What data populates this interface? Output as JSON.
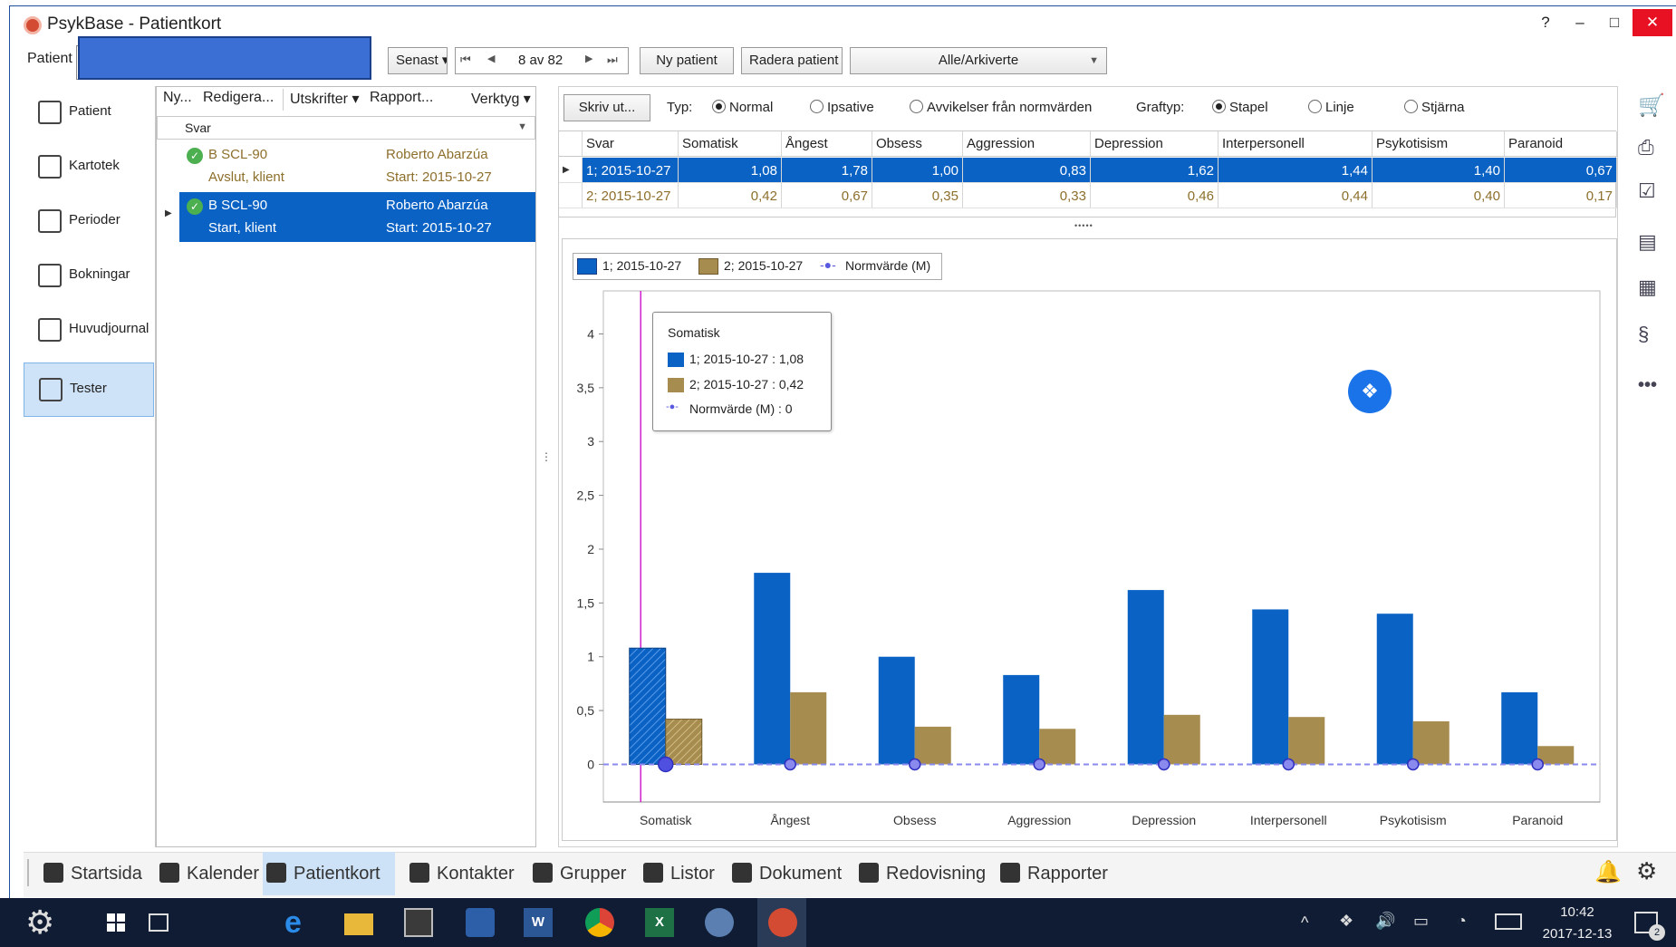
{
  "window": {
    "title": "PsykBase - Patientkort",
    "help": "?",
    "minimize": "–",
    "maximize": "□",
    "close": "✕"
  },
  "toolbar": {
    "patient_label": "Patient",
    "senast": "Senast ▾",
    "first": "⏮",
    "prev": "◀",
    "position": "8 av 82",
    "next": "▶",
    "last": "⏭",
    "new_patient": "Ny patient",
    "delete_patient": "Radera patient",
    "filter_value": "Alle/Arkiverte"
  },
  "nav": {
    "items": [
      {
        "label": "Patient",
        "icon": "caduceus-icon"
      },
      {
        "label": "Kartotek",
        "icon": "id-card-icon"
      },
      {
        "label": "Perioder",
        "icon": "calendar-clock-icon"
      },
      {
        "label": "Bokningar",
        "icon": "calendar-icon"
      },
      {
        "label": "Huvudjournal",
        "icon": "pen-icon"
      },
      {
        "label": "Tester",
        "icon": "head-icon"
      }
    ],
    "active": "Tester"
  },
  "mid": {
    "menu": {
      "new": "Ny...",
      "edit": "Redigera...",
      "print": "Utskrifter ▾",
      "report": "Rapport...",
      "tools": "Verktyg ▾"
    },
    "column": "Svar",
    "rows": [
      {
        "test": "B SCL-90",
        "who": "Roberto Abarzúa",
        "sub": "Avslut, klient",
        "start": "Start: 2015-10-27",
        "selected": false
      },
      {
        "test": "B SCL-90",
        "who": "Roberto Abarzúa",
        "sub": "Start, klient",
        "start": "Start: 2015-10-27",
        "selected": true
      }
    ]
  },
  "options": {
    "print": "Skriv ut...",
    "type_label": "Typ:",
    "types": [
      "Normal",
      "Ipsative",
      "Avvikelser från normvärden"
    ],
    "type_selected": "Normal",
    "graph_label": "Graftyp:",
    "graphs": [
      "Stapel",
      "Linje",
      "Stjärna"
    ],
    "graph_selected": "Stapel"
  },
  "table": {
    "headers": [
      "Svar",
      "Somatisk",
      "Ångest",
      "Obsess",
      "Aggression",
      "Depression",
      "Interpersonell",
      "Psykotisism",
      "Paranoid"
    ],
    "rows": [
      [
        "1; 2015-10-27",
        "1,08",
        "1,78",
        "1,00",
        "0,83",
        "1,62",
        "1,44",
        "1,40",
        "0,67"
      ],
      [
        "2; 2015-10-27",
        "0,42",
        "0,67",
        "0,35",
        "0,33",
        "0,46",
        "0,44",
        "0,40",
        "0,17"
      ]
    ],
    "splitter": "•••••"
  },
  "legend": {
    "items": [
      "1; 2015-10-27",
      "2; 2015-10-27",
      "Normvärde (M)"
    ]
  },
  "tooltip": {
    "title": "Somatisk",
    "lines": [
      "1; 2015-10-27 : 1,08",
      "2; 2015-10-27 : 0,42",
      "Normvärde (M) : 0"
    ]
  },
  "chart_data": {
    "type": "bar",
    "categories": [
      "Somatisk",
      "Ångest",
      "Obsess",
      "Aggression",
      "Depression",
      "Interpersonell",
      "Psykotisism",
      "Paranoid"
    ],
    "series": [
      {
        "name": "1; 2015-10-27",
        "color": "#0a62c4",
        "values": [
          1.08,
          1.78,
          1.0,
          0.83,
          1.62,
          1.44,
          1.4,
          0.67
        ]
      },
      {
        "name": "2; 2015-10-27",
        "color": "#a68c4e",
        "values": [
          0.42,
          0.67,
          0.35,
          0.33,
          0.46,
          0.44,
          0.4,
          0.17
        ]
      },
      {
        "name": "Normvärde (M)",
        "color": "#6a6ae8",
        "type": "line",
        "values": [
          0,
          0,
          0,
          0,
          0,
          0,
          0,
          0
        ]
      }
    ],
    "yticks": [
      "0",
      "0,5",
      "1",
      "1,5",
      "2",
      "2,5",
      "3",
      "3,5",
      "4"
    ],
    "ylim": [
      -0.35,
      4.4
    ],
    "legend": "top-left",
    "grid": false
  },
  "bottom": {
    "items": [
      {
        "label": "Startsida",
        "icon": "home-icon"
      },
      {
        "label": "Kalender",
        "icon": "calendar-icon"
      },
      {
        "label": "Patientkort",
        "icon": "person-icon"
      },
      {
        "label": "Kontakter",
        "icon": "contact-icon"
      },
      {
        "label": "Grupper",
        "icon": "group-icon"
      },
      {
        "label": "Listor",
        "icon": "list-icon"
      },
      {
        "label": "Dokument",
        "icon": "document-icon"
      },
      {
        "label": "Redovisning",
        "icon": "money-icon"
      },
      {
        "label": "Rapporter",
        "icon": "report-icon"
      }
    ],
    "active": "Patientkort"
  },
  "taskbar": {
    "time": "10:42",
    "date": "2017-12-13",
    "notif_count": "2"
  },
  "colors": {
    "accent": "#0a62c4",
    "series2": "#a68c4e",
    "norm": "#6a6ae8",
    "taskbar": "#101c34"
  }
}
